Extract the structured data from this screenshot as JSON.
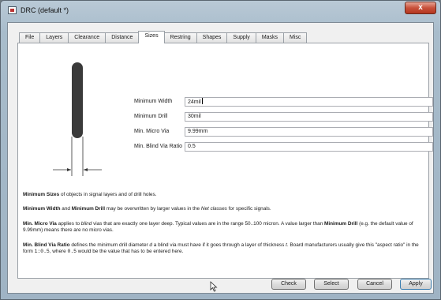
{
  "window": {
    "title": "DRC (default *)",
    "close_label": "x"
  },
  "tabs": [
    {
      "label": "File"
    },
    {
      "label": "Layers"
    },
    {
      "label": "Clearance"
    },
    {
      "label": "Distance"
    },
    {
      "label": "Sizes"
    },
    {
      "label": "Restring"
    },
    {
      "label": "Shapes"
    },
    {
      "label": "Supply"
    },
    {
      "label": "Masks"
    },
    {
      "label": "Misc"
    }
  ],
  "active_tab": "Sizes",
  "fields": [
    {
      "label": "Minimum Width",
      "value": "24mil"
    },
    {
      "label": "Minimum Drill",
      "value": "30mil"
    },
    {
      "label": "Min. Micro Via",
      "value": "9.99mm"
    },
    {
      "label": "Min. Blind Via Ratio",
      "value": "0.5"
    }
  ],
  "info": {
    "p1": {
      "b1": "Minimum Sizes",
      "t1": " of objects in signal layers and of drill holes."
    },
    "p2": {
      "b1": "Minimum Width",
      "t1": " and ",
      "b2": "Minimum Drill",
      "t2": " may be overwritten by larger values in the ",
      "i1": "Net classes",
      "t3": " for specific signals."
    },
    "p3": {
      "b1": "Min. Micro Via",
      "t1": " applies to ",
      "i1": "blind",
      "t2": " vias that are exactly one layer deep. Typical values are in the range 50..100 micron. A value larger than ",
      "b2": "Minimum Drill",
      "t3": " (e.g. the default value of 9.99mm) means there are no micro vias."
    },
    "p4": {
      "b1": "Min. Blind Via Ratio",
      "t1": " defines the minimum drill diameter ",
      "i1": "d",
      "t2": " a blind via must have if it goes through a layer of thickness ",
      "i2": "t",
      "t3": ". Board manufacturers usually give this \"aspect ratio\" in the form ",
      "m1": "1:0.5",
      "t4": ", where ",
      "m2": "0.5",
      "t5": " would be the value that has to be entered here."
    }
  },
  "buttons": {
    "check": "Check",
    "select": "Select",
    "cancel": "Cancel",
    "apply": "Apply"
  }
}
